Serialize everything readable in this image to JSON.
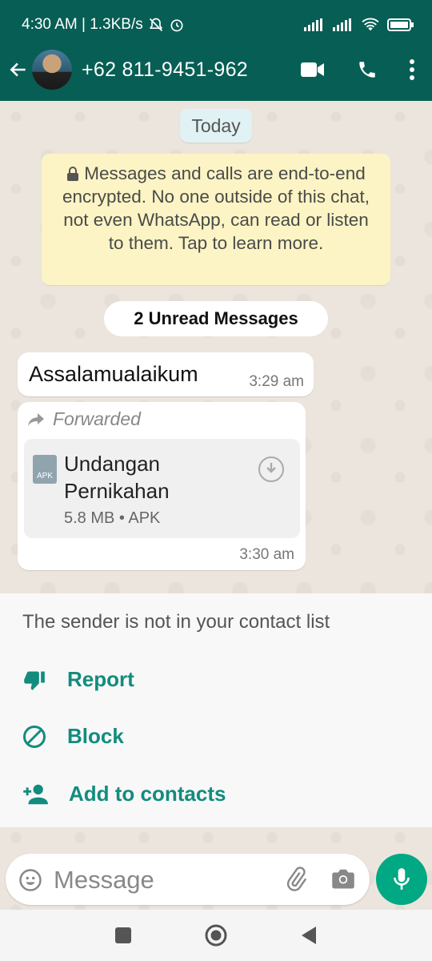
{
  "status_bar": {
    "time_network": "4:30 AM | 1.3KB/s"
  },
  "app_bar": {
    "contact_name": "+62 811-9451-962"
  },
  "chat": {
    "date_chip": "Today",
    "encryption_notice": "Messages and calls are end-to-end encrypted. No one outside of this chat, not even WhatsApp, can read or listen to them. Tap to learn more.",
    "unread_label": "2 Unread Messages",
    "messages": [
      {
        "text": "Assalamualaikum",
        "time": "3:29 am"
      },
      {
        "forwarded_label": "Forwarded",
        "document": {
          "icon_label": "APK",
          "name": "Undangan Pernikahan",
          "meta": "5.8 MB • APK"
        },
        "time": "3:30 am"
      }
    ]
  },
  "unknown_sender": {
    "notice": "The sender is not in your contact list",
    "actions": {
      "report": "Report",
      "block": "Block",
      "add": "Add to contacts"
    }
  },
  "composer": {
    "placeholder": "Message"
  },
  "colors": {
    "header": "#075e54",
    "accent": "#128c7e",
    "mic": "#00a884"
  }
}
